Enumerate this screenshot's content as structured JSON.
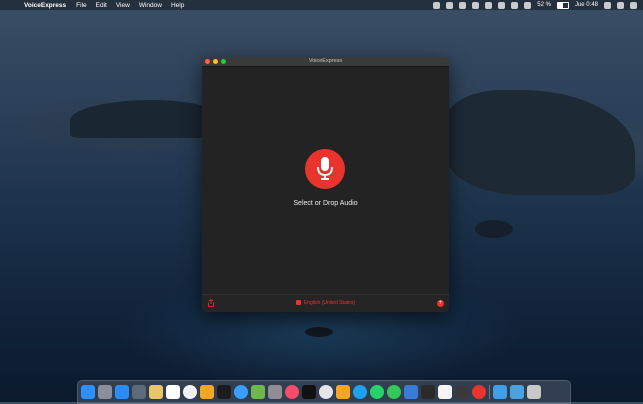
{
  "menubar": {
    "app_name": "VoiceExpress",
    "items": [
      "File",
      "Edit",
      "View",
      "Window",
      "Help"
    ],
    "battery_text": "52 %",
    "battery_level": 0.52,
    "clock": "Jue 0:48"
  },
  "window": {
    "title": "VoiceExpress",
    "drop_label": "Select or Drop Audio",
    "language": "English (United States)",
    "accent_color": "#e8342c"
  },
  "dock": {
    "icons": [
      "finder-icon",
      "launchpad-icon",
      "app-store-icon",
      "preview-icon",
      "notes-icon",
      "calendar-icon",
      "reminders-icon",
      "photos-icon",
      "stocks-icon",
      "safari-icon",
      "maps-icon",
      "system-preferences-icon",
      "music-icon",
      "tv-icon",
      "chrome-icon",
      "home-icon",
      "twitter-icon",
      "whatsapp-icon",
      "find-my-icon",
      "xcode-icon",
      "terminal-icon",
      "textedit-icon",
      "voiceexpress-icon",
      "alert-icon",
      "downloads-folder-icon",
      "documents-folder-icon",
      "trash-icon"
    ]
  }
}
